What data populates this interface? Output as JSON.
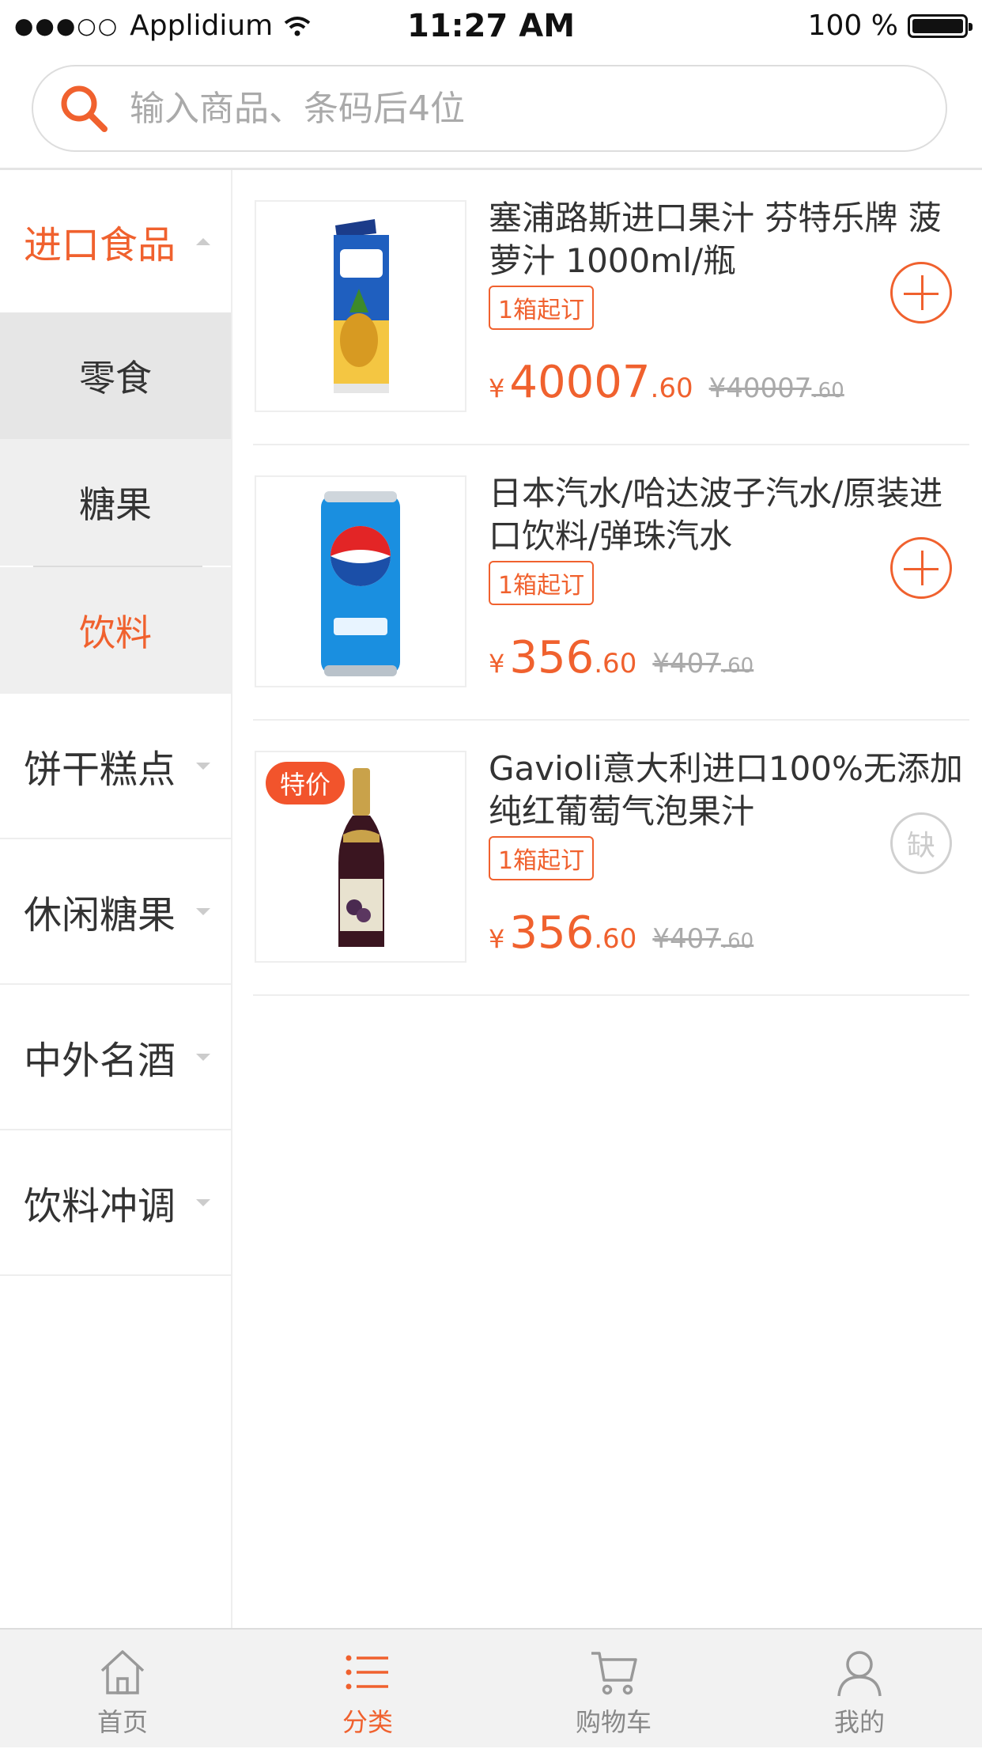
{
  "status_bar": {
    "carrier": "Applidium",
    "signal": "●●●○○",
    "time": "11:27 AM",
    "battery": "100 %"
  },
  "search": {
    "placeholder": "输入商品、条码后4位"
  },
  "sidebar": {
    "categories": [
      {
        "label": "进口食品",
        "active": true,
        "expanded": true
      },
      {
        "label": "饼干糕点"
      },
      {
        "label": "休闲糖果"
      },
      {
        "label": "中外名酒"
      },
      {
        "label": "饮料冲调"
      }
    ],
    "subcategories": [
      {
        "label": "零食"
      },
      {
        "label": "糖果"
      },
      {
        "label": "饮料",
        "active": true
      }
    ]
  },
  "products": [
    {
      "title": "塞浦路斯进口果汁 芬特乐牌 菠萝汁 1000ml/瓶",
      "moq": "1箱起订",
      "currency": "¥",
      "price_int": "40007",
      "price_dec": ".60",
      "orig_int": "¥40007",
      "orig_dec": ".60",
      "action": "add",
      "image": "pineapple-juice-carton"
    },
    {
      "title": "日本汽水/哈达波子汽水/原装进口饮料/弹珠汽水",
      "moq": "1箱起订",
      "currency": "¥",
      "price_int": "356",
      "price_dec": ".60",
      "orig_int": "¥407",
      "orig_dec": ".60",
      "action": "add",
      "image": "pepsi-blue-can"
    },
    {
      "title": "Gavioli意大利进口100%无添加纯红葡萄气泡果汁",
      "tag": "特价",
      "moq": "1箱起订",
      "currency": "¥",
      "price_int": "356",
      "price_dec": ".60",
      "orig_int": "¥407",
      "orig_dec": ".60",
      "action": "out_of_stock",
      "out_label": "缺",
      "image": "red-grape-bottle"
    }
  ],
  "tabbar": {
    "items": [
      {
        "label": "首页",
        "icon": "home-icon"
      },
      {
        "label": "分类",
        "icon": "list-icon",
        "active": true
      },
      {
        "label": "购物车",
        "icon": "cart-icon"
      },
      {
        "label": "我的",
        "icon": "user-icon"
      }
    ]
  },
  "colors": {
    "accent": "#f0612e",
    "sale_tag": "#f2542c"
  }
}
